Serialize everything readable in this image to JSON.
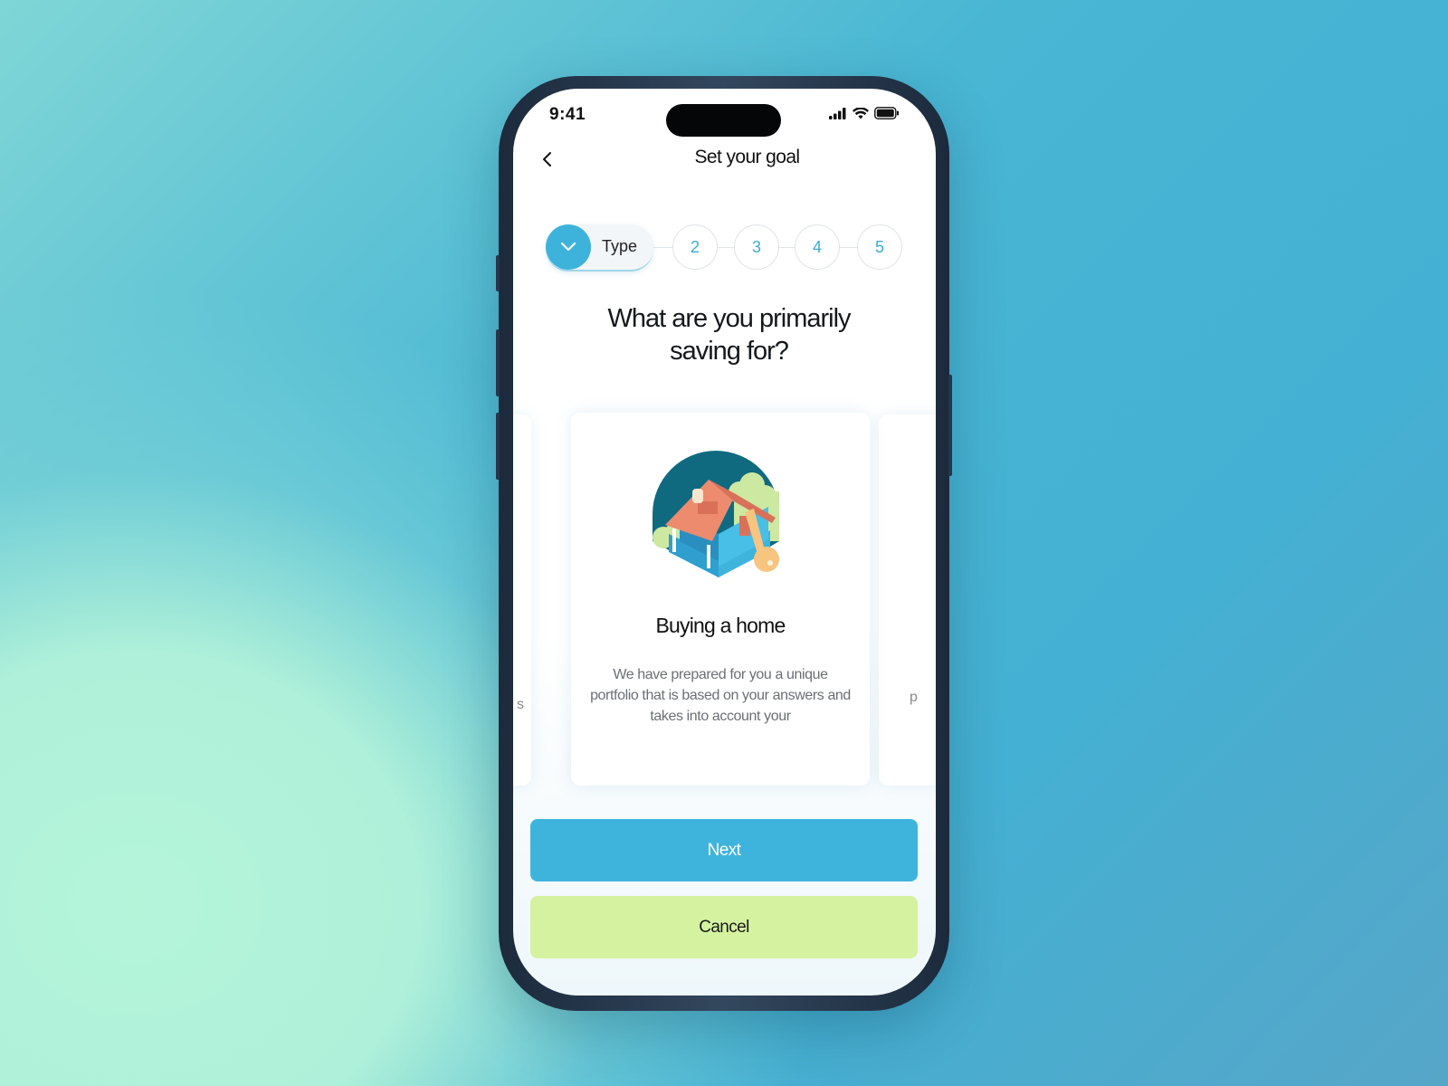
{
  "status_bar": {
    "time": "9:41",
    "icons": [
      "signal-icon",
      "wifi-icon",
      "battery-icon"
    ]
  },
  "nav": {
    "title": "Set your goal",
    "back_icon": "chevron-left-icon"
  },
  "stepper": {
    "current": {
      "label": "Type",
      "icon": "chevron-down-icon"
    },
    "steps": [
      "2",
      "3",
      "4",
      "5"
    ],
    "accent": "#3db3dc"
  },
  "question": {
    "line1": "What are you primarily",
    "line2": "saving for?"
  },
  "cards": {
    "active": {
      "title": "Buying a home",
      "description": "We have prepared for you a unique portfolio that is based on your answers and takes into account your",
      "illustration": "house-with-key-illustration"
    },
    "left_peek_text": "s",
    "right_peek_text": "p"
  },
  "actions": {
    "next_label": "Next",
    "cancel_label": "Cancel",
    "next_color": "#3eb4dd",
    "cancel_color": "#d5f2a0"
  }
}
